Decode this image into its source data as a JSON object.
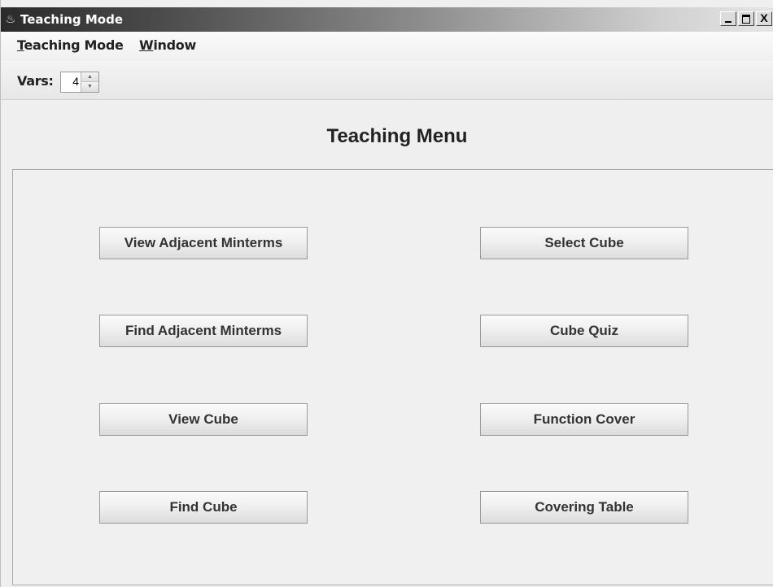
{
  "window": {
    "title": "Teaching Mode",
    "controls": {
      "minimize": "_",
      "maximize": "□",
      "close": "X"
    }
  },
  "menu": {
    "items": [
      {
        "mnemonic": "T",
        "rest": "eaching Mode"
      },
      {
        "mnemonic": "W",
        "rest": "indow"
      }
    ]
  },
  "toolbar": {
    "vars_label": "Vars:",
    "vars_value": "4"
  },
  "heading": "Teaching Menu",
  "buttons": {
    "left": [
      "View Adjacent Minterms",
      "Find Adjacent Minterms",
      "View Cube",
      "Find Cube"
    ],
    "right": [
      "Select Cube",
      "Cube Quiz",
      "Function Cover",
      "Covering Table"
    ]
  }
}
